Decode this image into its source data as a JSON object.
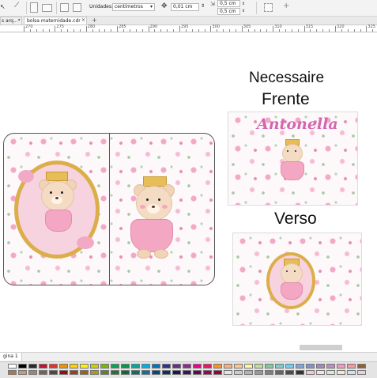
{
  "toolbar": {
    "units_label": "Unidades:",
    "units_value": "centímetros",
    "nudge_value": "0,01 cm",
    "dup_x": "0,5 cm",
    "dup_y": "0,5 cm"
  },
  "tabs": {
    "first_partial": "s arq...*",
    "active": "bolsa maternidade.cdr",
    "add_icon": "plus-icon"
  },
  "ruler": {
    "numbers": [
      "270",
      "275",
      "280",
      "285",
      "290",
      "295",
      "300",
      "305",
      "310",
      "315",
      "320",
      "325"
    ]
  },
  "canvas": {
    "title1": "Necessaire",
    "title2": "Frente",
    "title3": "Verso",
    "name_text": "Antonella"
  },
  "status": {
    "page_tab": "gina 1"
  },
  "colors": {
    "accent_pink": "#d466b0",
    "floral_bg": "#fdf8fa",
    "gold": "#e6bd57"
  },
  "palette": [
    "#ffffff",
    "#000000",
    "#2a2a2a",
    "#c8102e",
    "#e4322b",
    "#f39200",
    "#ffd100",
    "#fff200",
    "#c6d300",
    "#7ab800",
    "#00a651",
    "#00994d",
    "#00a99d",
    "#00aeef",
    "#0072bc",
    "#2e3192",
    "#662d91",
    "#92278f",
    "#ec008c",
    "#ed145b",
    "#f7941d",
    "#f9ad81",
    "#fdc68a",
    "#fff799",
    "#c4df9b",
    "#82ca9c",
    "#7accc8",
    "#6dcff6",
    "#7da7d9",
    "#8393ca",
    "#a187be",
    "#bc8dbf",
    "#f49ac2",
    "#f6989d",
    "#8c6239",
    "#a67c52",
    "#c69c6d",
    "#998675",
    "#736357",
    "#534741",
    "#9e0b0f",
    "#a0410d",
    "#a36209",
    "#aba000",
    "#598527",
    "#1a7b30",
    "#007236",
    "#00746b",
    "#0076a3",
    "#004a80",
    "#003471",
    "#1b1464",
    "#440e62",
    "#630460",
    "#9e005d",
    "#9e0039",
    "#e6e6e6",
    "#cccccc",
    "#b3b3b3",
    "#999999",
    "#808080",
    "#666666",
    "#4d4d4d",
    "#333333",
    "#f5c6d6",
    "#f9dde8",
    "#d9ead3",
    "#fce5cd",
    "#cfe2f3",
    "#ead1dc"
  ]
}
